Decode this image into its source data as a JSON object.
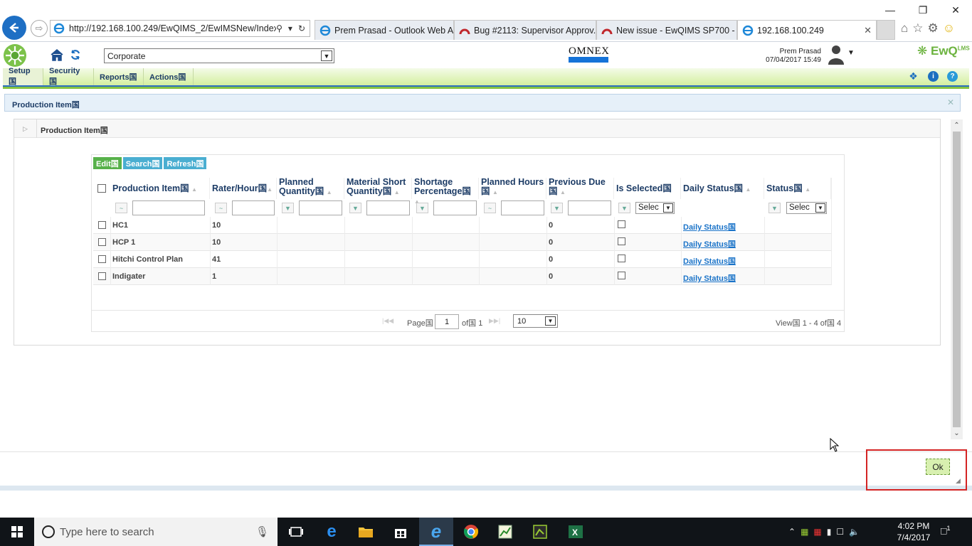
{
  "browser": {
    "url": "http://192.168.100.249/EwQIMS_2/EwIMSNew/Index/Ir",
    "tabs": [
      {
        "label": "Prem Prasad - Outlook Web A..."
      },
      {
        "label": "Bug #2113: Supervisor Approv..."
      },
      {
        "label": "New issue - EwQIMS SP700 - ..."
      },
      {
        "label": "192.168.100.249"
      }
    ]
  },
  "header": {
    "org_select": "Corporate",
    "brand": "OMNEX",
    "user_name": "Prem Prasad",
    "user_datetime": "07/04/2017 15:49",
    "product": "EwQ",
    "product_sup": "LMS"
  },
  "menu": {
    "items": [
      {
        "label": "Setup国"
      },
      {
        "label": "Security国"
      },
      {
        "label": "Reports国"
      },
      {
        "label": "Actions国"
      }
    ]
  },
  "panel": {
    "title": "Production Item国",
    "section_title": "Production Item国"
  },
  "grid": {
    "toolbar": {
      "edit": "Edit国",
      "search": "Search国",
      "refresh": "Refresh国"
    },
    "columns": [
      {
        "line1": "Production Item国",
        "line2": ""
      },
      {
        "line1": "Rater/Hour国",
        "line2": ""
      },
      {
        "line1": "Planned",
        "line2": "Quantity国"
      },
      {
        "line1": "Material Short",
        "line2": "Quantity国"
      },
      {
        "line1": "Shortage",
        "line2": "Percentage国"
      },
      {
        "line1": "Planned Hours",
        "line2": "国"
      },
      {
        "line1": "Previous Due",
        "line2": "国"
      },
      {
        "line1": "Is Selected国",
        "line2": ""
      },
      {
        "line1": "Daily Status国",
        "line2": ""
      },
      {
        "line1": "Status国",
        "line2": ""
      }
    ],
    "filters": {
      "is_selected": "Selec",
      "status": "Selec"
    },
    "rows": [
      {
        "item": "HC1",
        "rate": "10",
        "due": "0",
        "daily": "Daily Status国"
      },
      {
        "item": "HCP 1",
        "rate": "10",
        "due": "0",
        "daily": "Daily Status国"
      },
      {
        "item": "Hitchi Control Plan",
        "rate": "41",
        "due": "0",
        "daily": "Daily Status国"
      },
      {
        "item": "Indigater",
        "rate": "1",
        "due": "0",
        "daily": "Daily Status国"
      }
    ],
    "pager": {
      "page_label": "Page国",
      "page": "1",
      "of_label": "of国 1",
      "page_size": "10",
      "view_text": "View国 1 - 4 of国 4"
    }
  },
  "footer": {
    "ok_label": "Ok"
  },
  "taskbar": {
    "search_placeholder": "Type here to search",
    "time": "4:02 PM",
    "date": "7/4/2017",
    "notification_count": "1"
  },
  "colors": {
    "menu_green": "#d4ef9f",
    "brand_blue": "#1673d8",
    "ok_frame": "#d42424",
    "link": "#1a73c8"
  }
}
